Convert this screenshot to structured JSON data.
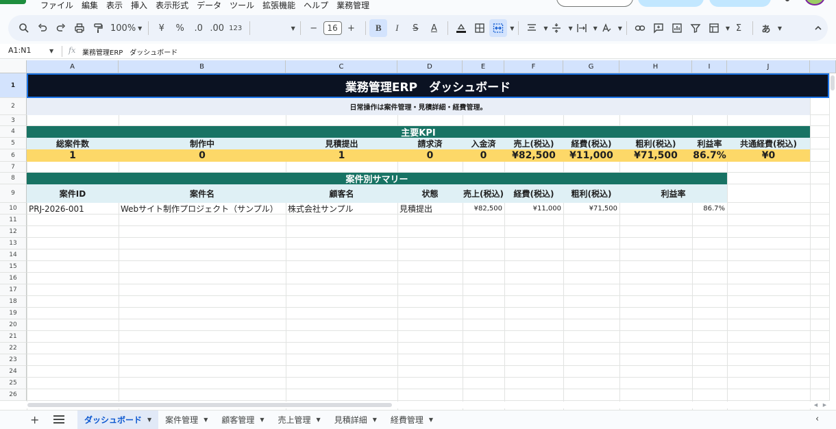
{
  "menu": [
    "ファイル",
    "編集",
    "表示",
    "挿入",
    "表示形式",
    "データ",
    "ツール",
    "拡張機能",
    "ヘルプ",
    "業務管理"
  ],
  "toolbar": {
    "zoom": "100%",
    "currency": "¥",
    "percent": "%",
    "dec_decrease": ".0",
    "dec_increase": ".00",
    "number_format": "123",
    "font_name": "",
    "font_size": "16",
    "minus": "−",
    "plus": "+",
    "input_tools": "あ",
    "sum_symbol": "Σ"
  },
  "formula_bar": {
    "name_box": "A1:N1",
    "fx": "fx",
    "content": "業務管理ERP　ダッシュボード"
  },
  "columns": [
    "A",
    "B",
    "C",
    "D",
    "E",
    "F",
    "G",
    "H",
    "I",
    "J"
  ],
  "rows": [
    "1",
    "2",
    "3",
    "4",
    "5",
    "6",
    "7",
    "8",
    "9",
    "10",
    "11",
    "12",
    "13",
    "14",
    "15",
    "16",
    "17",
    "18",
    "19",
    "20",
    "21",
    "22",
    "23",
    "24",
    "25",
    "26"
  ],
  "sheet": {
    "title": "業務管理ERP　ダッシュボード",
    "subtitle": "日常操作は案件管理・見積詳細・経費管理。",
    "kpi_header": "主要KPI",
    "kpi_labels": [
      "総案件数",
      "制作中",
      "見積提出",
      "請求済",
      "入金済",
      "売上(税込)",
      "経費(税込)",
      "粗利(税込)",
      "利益率",
      "共通経費(税込)"
    ],
    "kpi_values": [
      "1",
      "0",
      "1",
      "0",
      "0",
      "¥82,500",
      "¥11,000",
      "¥71,500",
      "86.7%",
      "¥0"
    ],
    "summary_header": "案件別サマリー",
    "summary_columns": [
      "案件ID",
      "案件名",
      "顧客名",
      "状態",
      "売上(税込)",
      "経費(税込)",
      "粗利(税込)",
      "利益率"
    ],
    "summary_rows": [
      [
        "PRJ-2026-001",
        "Webサイト制作プロジェクト（サンプル）",
        "株式会社サンプル",
        "見積提出",
        "¥82,500",
        "¥11,000",
        "¥71,500",
        "86.7%"
      ]
    ]
  },
  "tabs": {
    "add": "+",
    "items": [
      "ダッシュボード",
      "案件管理",
      "顧客管理",
      "売上管理",
      "見積詳細",
      "経費管理"
    ],
    "active": 0,
    "nav": "‹"
  },
  "colors": {
    "title_bg": "#0b1222",
    "teal": "#187364",
    "kpi_value_bg": "#fdd868",
    "label_bg": "#dff0f5",
    "selection": "#d3e3fd"
  }
}
